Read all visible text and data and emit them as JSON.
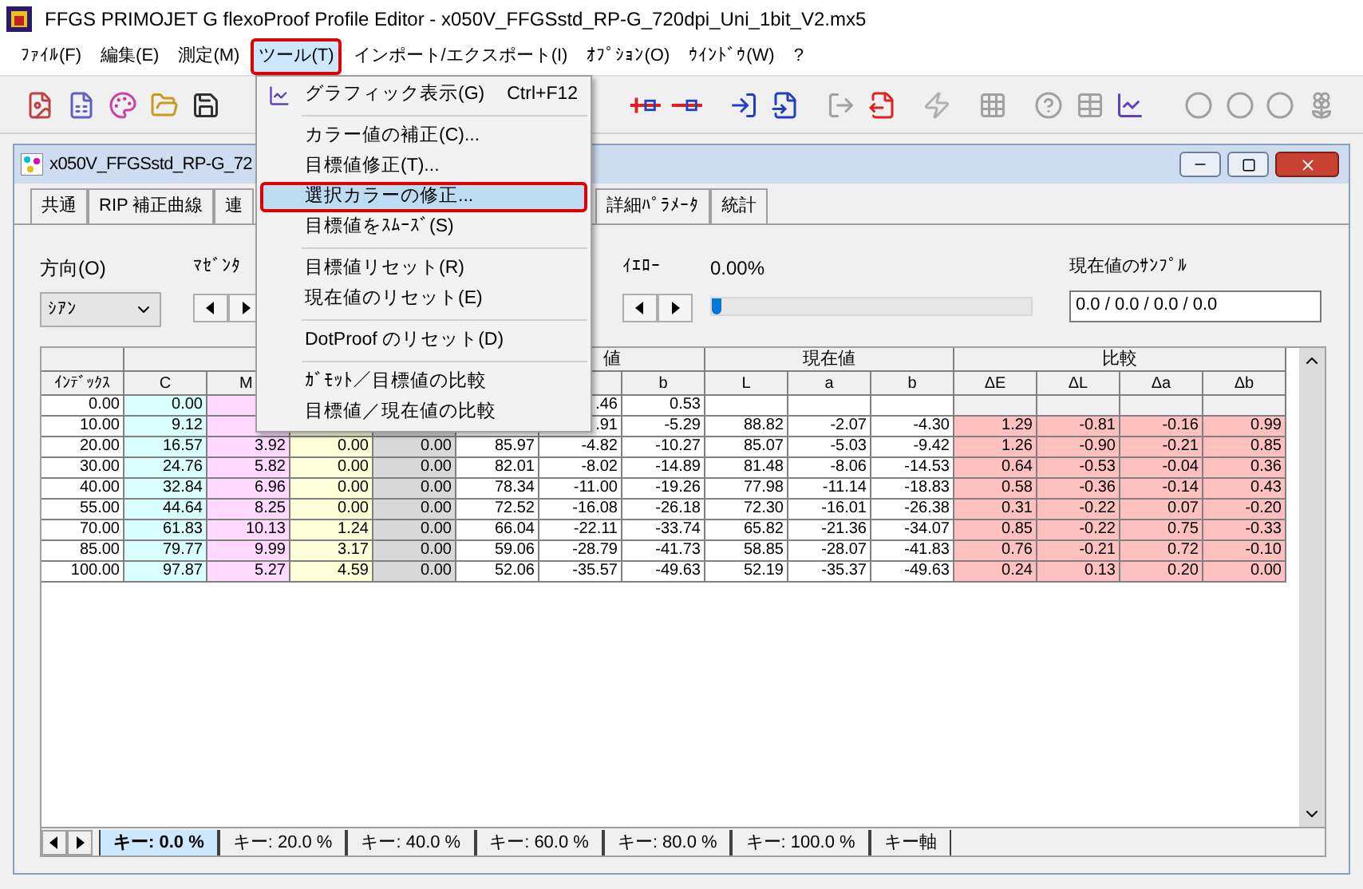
{
  "app_title": "FFGS PRIMOJET G flexoProof Profile Editor - x050V_FFGSstd_RP-G_720dpi_Uni_1bit_V2.mx5",
  "menu_bar": [
    {
      "label": "ﾌｧｲﾙ(F)",
      "selected": false,
      "annotated": false
    },
    {
      "label": "編集(E)",
      "selected": false,
      "annotated": false
    },
    {
      "label": "測定(M)",
      "selected": false,
      "annotated": false
    },
    {
      "label": "ツール(T)",
      "selected": true,
      "annotated": true
    },
    {
      "label": "インポート/エクスポート(I)",
      "selected": false,
      "annotated": false
    },
    {
      "label": "ｵﾌﾟｼｮﾝ(O)",
      "selected": false,
      "annotated": false
    },
    {
      "label": "ｳｲﾝﾄﾞｳ(W)",
      "selected": false,
      "annotated": false
    },
    {
      "label": "?",
      "selected": false,
      "annotated": false
    }
  ],
  "open_menu": [
    {
      "kind": "item",
      "label": "グラフィック表示(G)",
      "shortcut": "Ctrl+F12",
      "icon": true,
      "selected": false,
      "annotated": false
    },
    {
      "kind": "separator"
    },
    {
      "kind": "item",
      "label": "カラー値の補正(C)...",
      "selected": false,
      "annotated": false
    },
    {
      "kind": "item",
      "label": "目標値修正(T)...",
      "selected": false,
      "annotated": false
    },
    {
      "kind": "item",
      "label": "選択カラーの修正...",
      "selected": true,
      "annotated": true
    },
    {
      "kind": "item",
      "label": "目標値をｽﾑｰｽﾞ(S)",
      "selected": false,
      "annotated": false
    },
    {
      "kind": "separator"
    },
    {
      "kind": "item",
      "label": "目標値リセット(R)",
      "selected": false,
      "annotated": false
    },
    {
      "kind": "item",
      "label": "現在値のリセット(E)",
      "selected": false,
      "annotated": false
    },
    {
      "kind": "separator"
    },
    {
      "kind": "item",
      "label": "DotProof のリセット(D)",
      "selected": false,
      "annotated": false
    },
    {
      "kind": "separator"
    },
    {
      "kind": "item",
      "label": "ｶﾞﾓｯﾄ／目標値の比較",
      "selected": false,
      "annotated": false
    },
    {
      "kind": "item",
      "label": "目標値／現在値の比較",
      "selected": false,
      "annotated": false
    }
  ],
  "document": {
    "title": "x050V_FFGSstd_RP-G_72",
    "tabs": [
      {
        "label": "共通",
        "selected": false
      },
      {
        "label": "RIP 補正曲線",
        "selected": false
      },
      {
        "label": "連",
        "selected": false
      },
      {
        "label": "詳細ﾊﾟﾗﾒｰﾀ",
        "selected": false
      },
      {
        "label": "統計",
        "selected": false
      }
    ],
    "direction": {
      "label": "方向(O)",
      "value": "ｼｱﾝ"
    },
    "magenta": {
      "label": "ﾏｾﾞﾝﾀ"
    },
    "yellow": {
      "label": "ｲｴﾛｰ",
      "reading": "0.00%",
      "level": 0
    },
    "sample": {
      "label": "現在値のｻﾝﾌﾟﾙ",
      "value": "0.0 / 0.0 / 0.0 / 0.0"
    },
    "table": {
      "groups": [
        {
          "label": "値"
        },
        {
          "label": "現在値"
        },
        {
          "label": "比較"
        }
      ],
      "columns": [
        "ｲﾝﾃﾞｯｸｽ",
        "C",
        "M",
        null,
        null,
        null,
        null,
        "b",
        "L",
        "a",
        "b",
        "ΔE",
        "ΔL",
        "Δa",
        "Δb"
      ],
      "rows": [
        {
          "measured": false,
          "cells": [
            "0.00",
            "0.00",
            null,
            null,
            null,
            null,
            ".46",
            "0.53",
            null,
            null,
            null,
            null,
            null,
            null,
            null
          ]
        },
        {
          "measured": true,
          "cells": [
            "10.00",
            "9.12",
            null,
            null,
            null,
            null,
            ".91",
            "-5.29",
            "88.82",
            "-2.07",
            "-4.30",
            "1.29",
            "-0.81",
            "-0.16",
            "0.99"
          ]
        },
        {
          "measured": true,
          "cells": [
            "20.00",
            "16.57",
            "3.92",
            "0.00",
            "0.00",
            "85.97",
            "-4.82",
            "-10.27",
            "85.07",
            "-5.03",
            "-9.42",
            "1.26",
            "-0.90",
            "-0.21",
            "0.85"
          ]
        },
        {
          "measured": true,
          "cells": [
            "30.00",
            "24.76",
            "5.82",
            "0.00",
            "0.00",
            "82.01",
            "-8.02",
            "-14.89",
            "81.48",
            "-8.06",
            "-14.53",
            "0.64",
            "-0.53",
            "-0.04",
            "0.36"
          ]
        },
        {
          "measured": true,
          "cells": [
            "40.00",
            "32.84",
            "6.96",
            "0.00",
            "0.00",
            "78.34",
            "-11.00",
            "-19.26",
            "77.98",
            "-11.14",
            "-18.83",
            "0.58",
            "-0.36",
            "-0.14",
            "0.43"
          ]
        },
        {
          "measured": true,
          "cells": [
            "55.00",
            "44.64",
            "8.25",
            "0.00",
            "0.00",
            "72.52",
            "-16.08",
            "-26.18",
            "72.30",
            "-16.01",
            "-26.38",
            "0.31",
            "-0.22",
            "0.07",
            "-0.20"
          ]
        },
        {
          "measured": true,
          "cells": [
            "70.00",
            "61.83",
            "10.13",
            "1.24",
            "0.00",
            "66.04",
            "-22.11",
            "-33.74",
            "65.82",
            "-21.36",
            "-34.07",
            "0.85",
            "-0.22",
            "0.75",
            "-0.33"
          ]
        },
        {
          "measured": true,
          "cells": [
            "85.00",
            "79.77",
            "9.99",
            "3.17",
            "0.00",
            "59.06",
            "-28.79",
            "-41.73",
            "58.85",
            "-28.07",
            "-41.83",
            "0.76",
            "-0.21",
            "0.72",
            "-0.10"
          ]
        },
        {
          "measured": true,
          "cells": [
            "100.00",
            "97.87",
            "5.27",
            "4.59",
            "0.00",
            "52.06",
            "-35.57",
            "-49.63",
            "52.19",
            "-35.37",
            "-49.63",
            "0.24",
            "0.13",
            "0.20",
            "0.00"
          ]
        }
      ]
    },
    "sheet_tabs": [
      {
        "label": "キー: 0.0 %",
        "selected": true
      },
      {
        "label": "キー: 20.0 %",
        "selected": false
      },
      {
        "label": "キー: 40.0 %",
        "selected": false
      },
      {
        "label": "キー: 60.0 %",
        "selected": false
      },
      {
        "label": "キー: 80.0 %",
        "selected": false
      },
      {
        "label": "キー: 100.0 %",
        "selected": false
      },
      {
        "label": "キー軸",
        "selected": false
      }
    ]
  }
}
